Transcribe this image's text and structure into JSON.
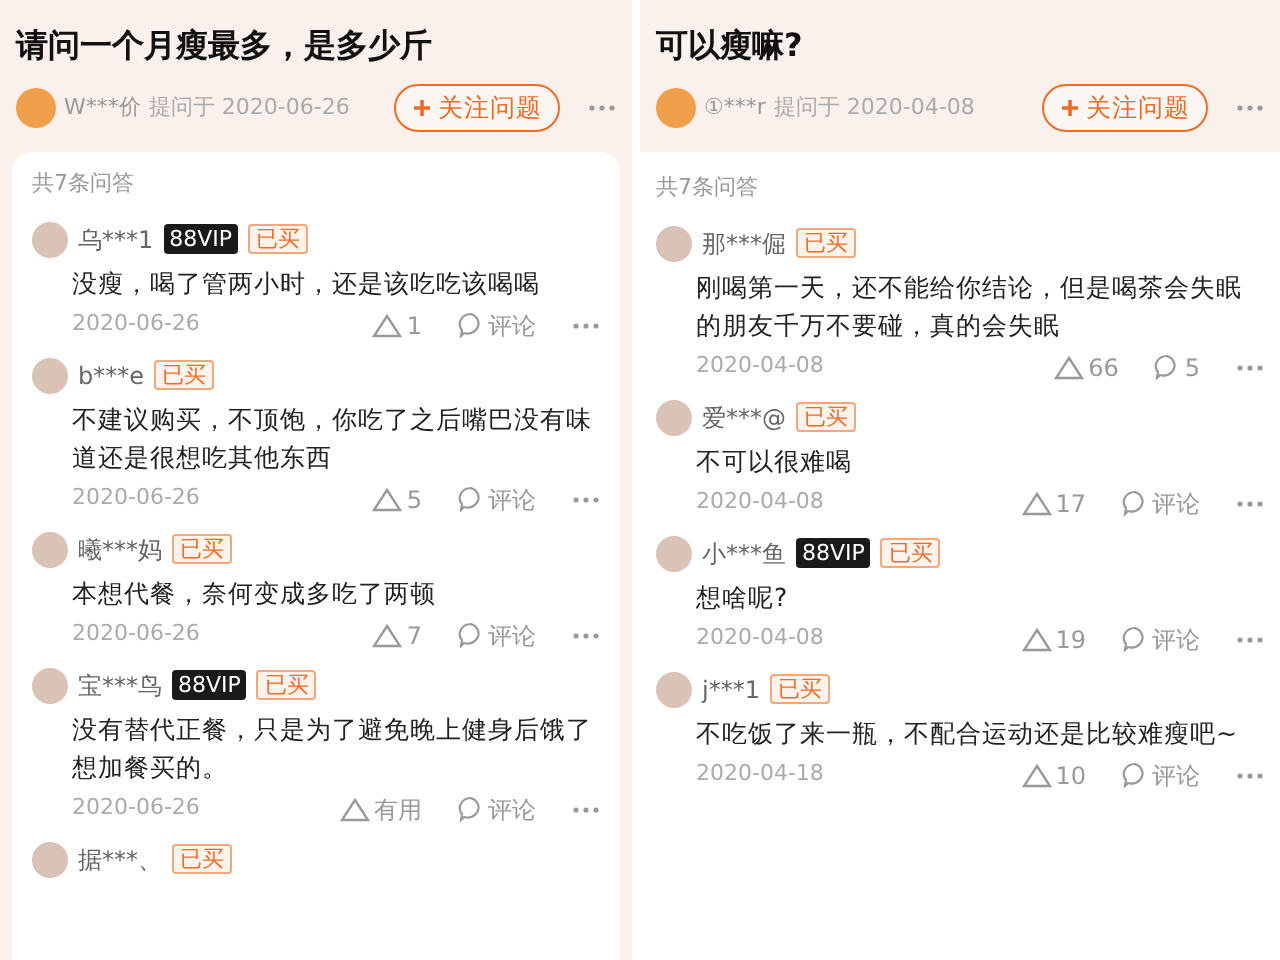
{
  "panels": [
    {
      "title": "请问一个月瘦最多，是多少斤",
      "asker": {
        "name": "W***价",
        "prefix": "提问于",
        "date": "2020-06-26"
      },
      "follow_button": "关注问题",
      "count": "共7条问答",
      "card": true,
      "answers": [
        {
          "user": "乌***1",
          "badges": [
            {
              "kind": "vip",
              "text": "88VIP"
            },
            {
              "kind": "bought",
              "text": "已买"
            }
          ],
          "text": "没瘦，喝了管两小时，还是该吃吃该喝喝",
          "date": "2020-06-26",
          "likes": "1",
          "comments": "评论"
        },
        {
          "user": "b***e",
          "badges": [
            {
              "kind": "bought",
              "text": "已买"
            }
          ],
          "text": "不建议购买，不顶饱，你吃了之后嘴巴没有味道还是很想吃其他东西",
          "date": "2020-06-26",
          "likes": "5",
          "comments": "评论"
        },
        {
          "user": "曦***妈",
          "badges": [
            {
              "kind": "bought",
              "text": "已买"
            }
          ],
          "text": "本想代餐，奈何变成多吃了两顿",
          "date": "2020-06-26",
          "likes": "7",
          "comments": "评论"
        },
        {
          "user": "宝***鸟",
          "badges": [
            {
              "kind": "vip",
              "text": "88VIP"
            },
            {
              "kind": "bought",
              "text": "已买"
            }
          ],
          "text": "没有替代正餐，只是为了避免晚上健身后饿了想加餐买的。",
          "date": "2020-06-26",
          "likes": "有用",
          "comments": "评论"
        },
        {
          "user": "据***、",
          "badges": [
            {
              "kind": "bought",
              "text": "已买"
            }
          ]
        }
      ]
    },
    {
      "title": "可以瘦嘛?",
      "asker": {
        "name": "①***r",
        "prefix": "提问于",
        "date": "2020-04-08"
      },
      "follow_button": "关注问题",
      "count": "共7条问答",
      "card": false,
      "answers": [
        {
          "user": "那***倔",
          "badges": [
            {
              "kind": "bought",
              "text": "已买"
            }
          ],
          "text": "刚喝第一天，还不能给你结论，但是喝茶会失眠的朋友千万不要碰，真的会失眠",
          "date": "2020-04-08",
          "likes": "66",
          "comments": "5"
        },
        {
          "user": "爱***@",
          "badges": [
            {
              "kind": "bought",
              "text": "已买"
            }
          ],
          "text": "不可以很难喝",
          "date": "2020-04-08",
          "likes": "17",
          "comments": "评论"
        },
        {
          "user": "小***鱼",
          "badges": [
            {
              "kind": "vip",
              "text": "88VIP"
            },
            {
              "kind": "bought",
              "text": "已买"
            }
          ],
          "text": "想啥呢?",
          "date": "2020-04-08",
          "likes": "19",
          "comments": "评论"
        },
        {
          "user": "j***1",
          "badges": [
            {
              "kind": "bought",
              "text": "已买"
            }
          ],
          "text": "不吃饭了来一瓶，不配合运动还是比较难瘦吧~",
          "date": "2020-04-18",
          "likes": "10",
          "comments": "评论"
        }
      ]
    }
  ]
}
